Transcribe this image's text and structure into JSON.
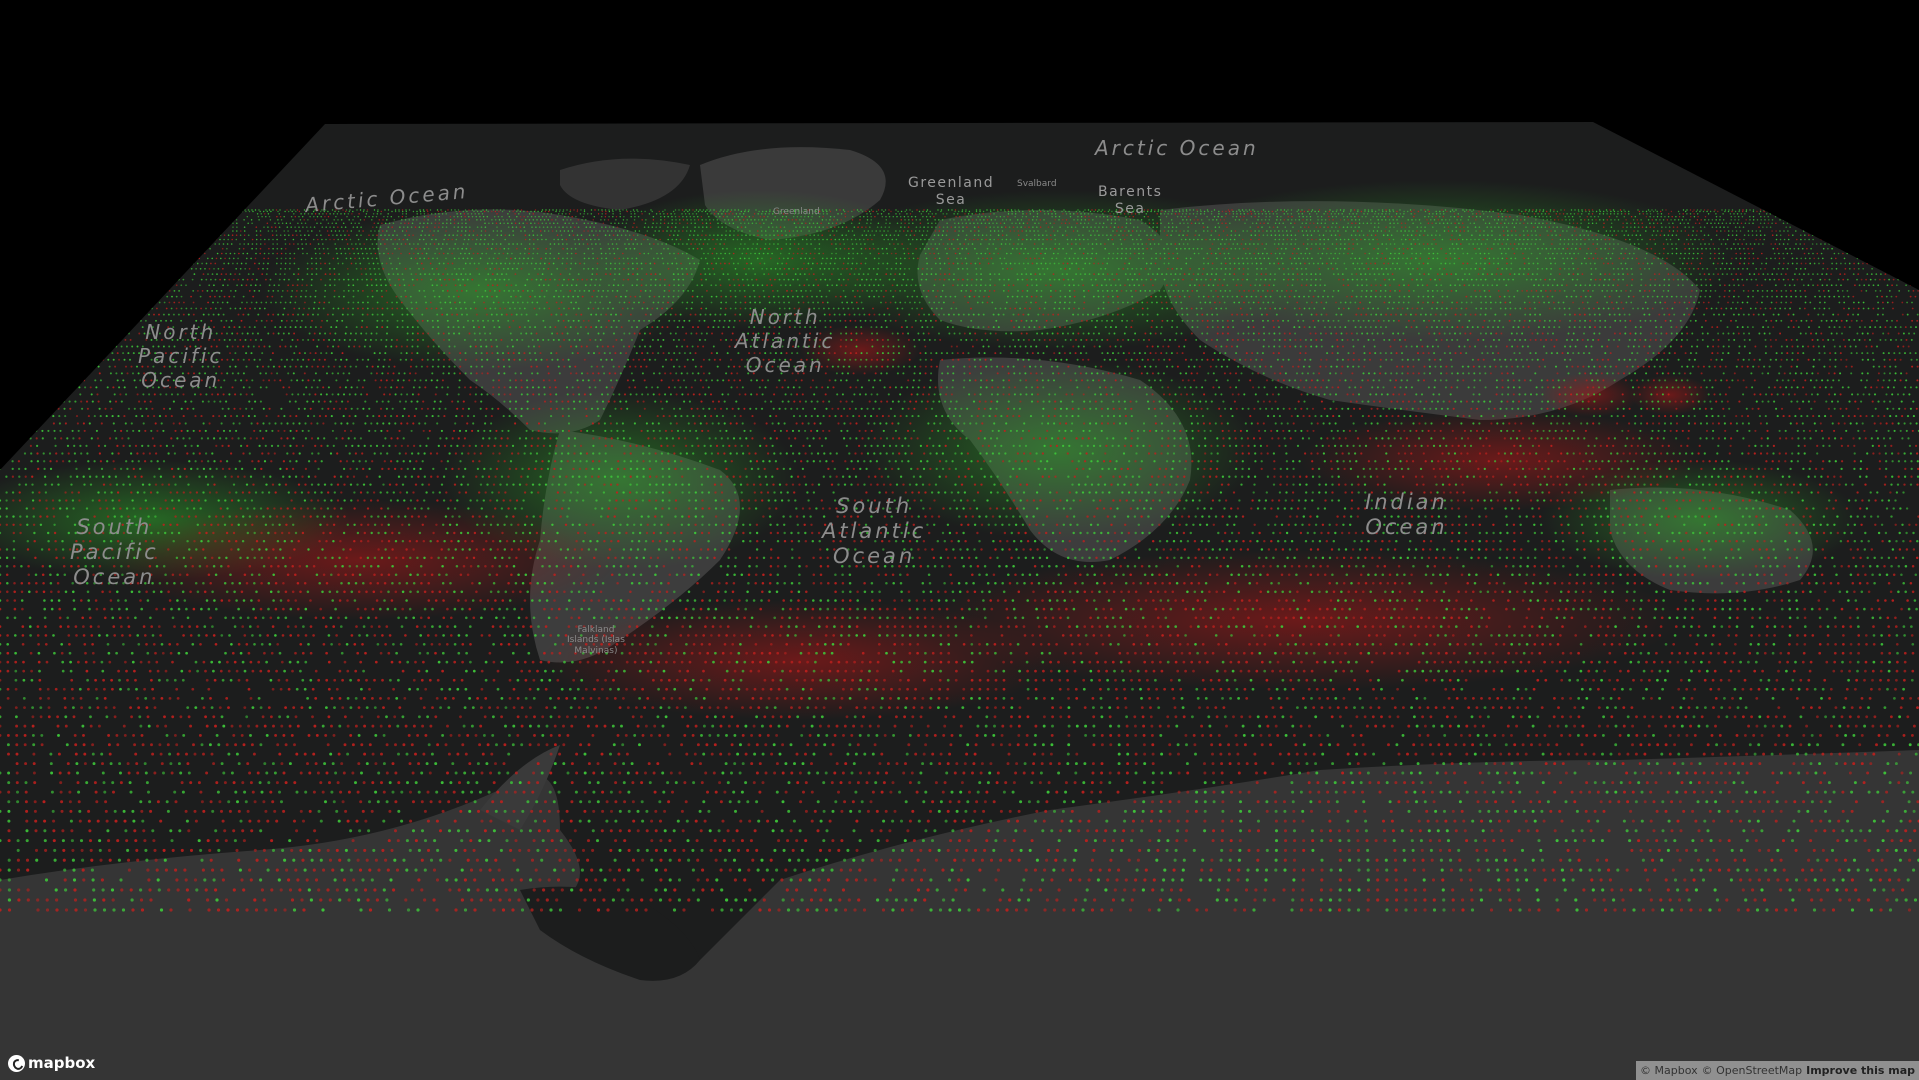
{
  "map": {
    "ocean_labels": [
      {
        "text": "Arctic Ocean",
        "id": "arctic-ocean-west"
      },
      {
        "text": "Arctic Ocean",
        "id": "arctic-ocean-east"
      },
      {
        "text": "North\nPacific\nOcean",
        "id": "north-pacific"
      },
      {
        "text": "North\nAtlantic\nOcean",
        "id": "north-atlantic"
      },
      {
        "text": "South\nPacific\nOcean",
        "id": "south-pacific"
      },
      {
        "text": "South\nAtlantic\nOcean",
        "id": "south-atlantic"
      },
      {
        "text": "Indian\nOcean",
        "id": "indian-ocean"
      }
    ],
    "sea_labels": [
      {
        "text": "Greenland\nSea",
        "id": "greenland-sea"
      },
      {
        "text": "Barents\nSea",
        "id": "barents-sea"
      }
    ],
    "small_labels": [
      {
        "text": "Svalbard",
        "id": "svalbard"
      },
      {
        "text": "Greenland",
        "id": "greenland"
      },
      {
        "text": "Falkland\nIslands (Islas\nMalvinas)",
        "id": "falkland-islands"
      }
    ],
    "colors": {
      "background": "#000000",
      "land": "#3a3a3a",
      "water": "#1c1d1d",
      "dot_green": "#3ec93a",
      "dot_red": "#c0201d"
    }
  },
  "logo": {
    "text": "mapbox"
  },
  "attribution": {
    "mapbox": "© Mapbox",
    "osm": "© OpenStreetMap",
    "improve": "Improve this map"
  }
}
